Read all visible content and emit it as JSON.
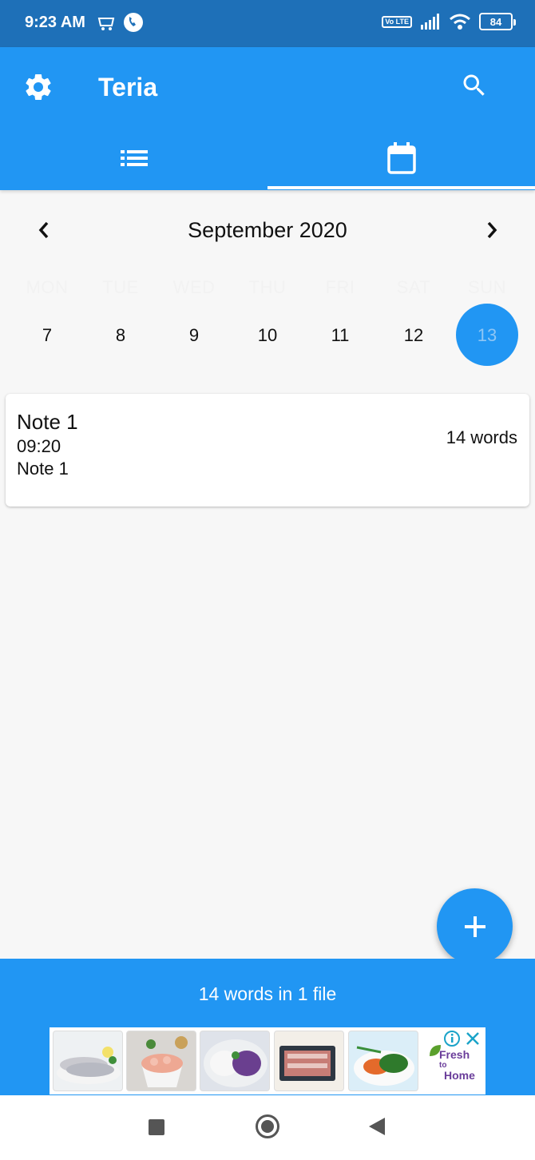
{
  "status_bar": {
    "time": "9:23 AM",
    "volte_label": "Vo LTE",
    "battery_level": "84",
    "icons": [
      "shopping-cart-icon",
      "phone-call-icon",
      "signal-icon",
      "wifi-icon",
      "battery-icon"
    ]
  },
  "app_bar": {
    "title": "Teria",
    "settings_icon": "gear-icon",
    "search_icon": "search-icon",
    "tabs": [
      {
        "name": "list",
        "icon": "list-icon",
        "selected": false
      },
      {
        "name": "calendar",
        "icon": "calendar-icon",
        "selected": true
      }
    ]
  },
  "calendar": {
    "month_title": "September 2020",
    "weekdays": [
      "MON",
      "TUE",
      "WED",
      "THU",
      "FRI",
      "SAT",
      "SUN"
    ],
    "days": [
      "7",
      "8",
      "9",
      "10",
      "11",
      "12",
      "13"
    ],
    "selected_day": "13"
  },
  "notes": [
    {
      "title": "Note 1",
      "time": "09:20",
      "preview": "Note 1",
      "words": "14 words"
    }
  ],
  "footer": {
    "summary": "14 words in 1 file"
  },
  "ad": {
    "brand_line1": "Fresh",
    "brand_line2": "to",
    "brand_line3": "Home"
  },
  "colors": {
    "primary": "#2196f3",
    "status_bar": "#1e70b8"
  }
}
